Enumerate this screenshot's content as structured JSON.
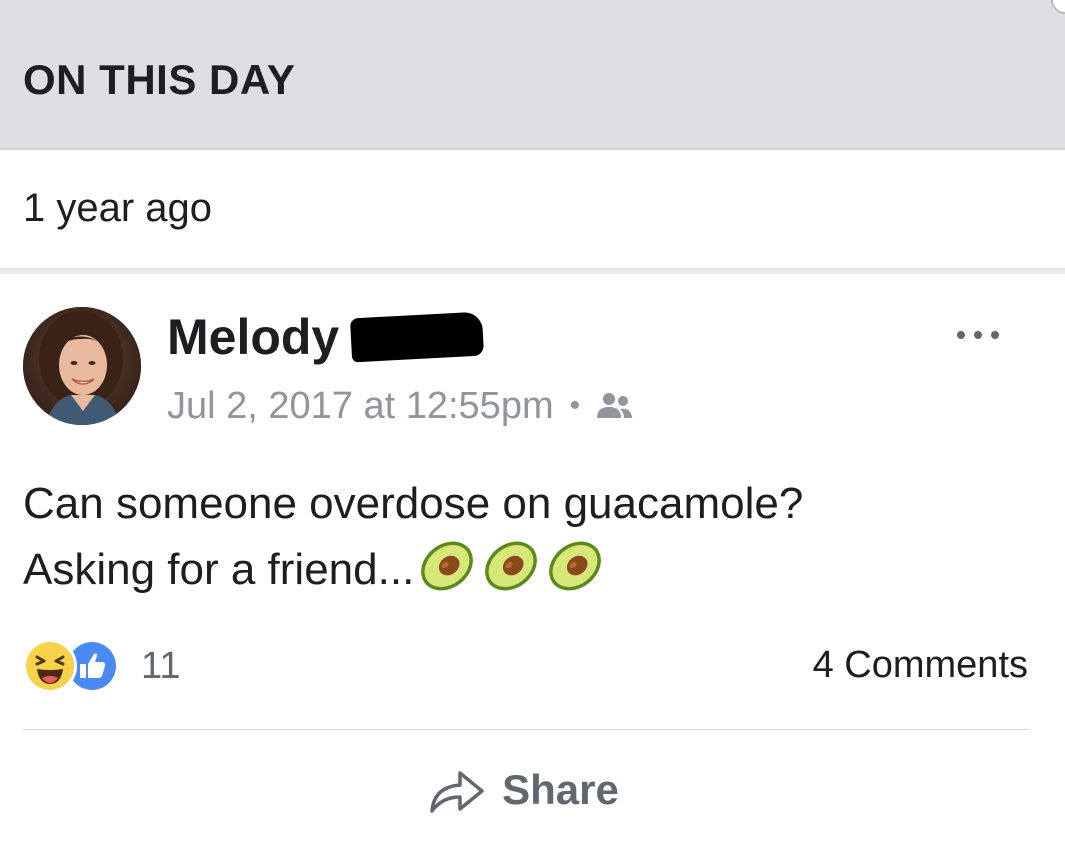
{
  "section": {
    "title": "ON THIS DAY",
    "time_ago": "1 year ago"
  },
  "post": {
    "author_name": "Melody",
    "timestamp": "Jul 2, 2017 at 12:55pm",
    "separator": "•",
    "audience_icon": "friends-icon",
    "text_line_1": "Can someone overdose on guacamole?",
    "text_line_2": "Asking for a friend...",
    "emoji": [
      "avocado",
      "avocado",
      "avocado"
    ],
    "reactions": {
      "types": [
        "haha",
        "like"
      ],
      "count": "11"
    },
    "comments_label": "4 Comments",
    "actions": {
      "share_label": "Share"
    }
  },
  "colors": {
    "header_bg": "#dddfe2",
    "secondary_text": "#90949c",
    "like_blue": "#4a8af4",
    "haha_yellow": "#f7d24a",
    "action_gray": "#606770"
  }
}
